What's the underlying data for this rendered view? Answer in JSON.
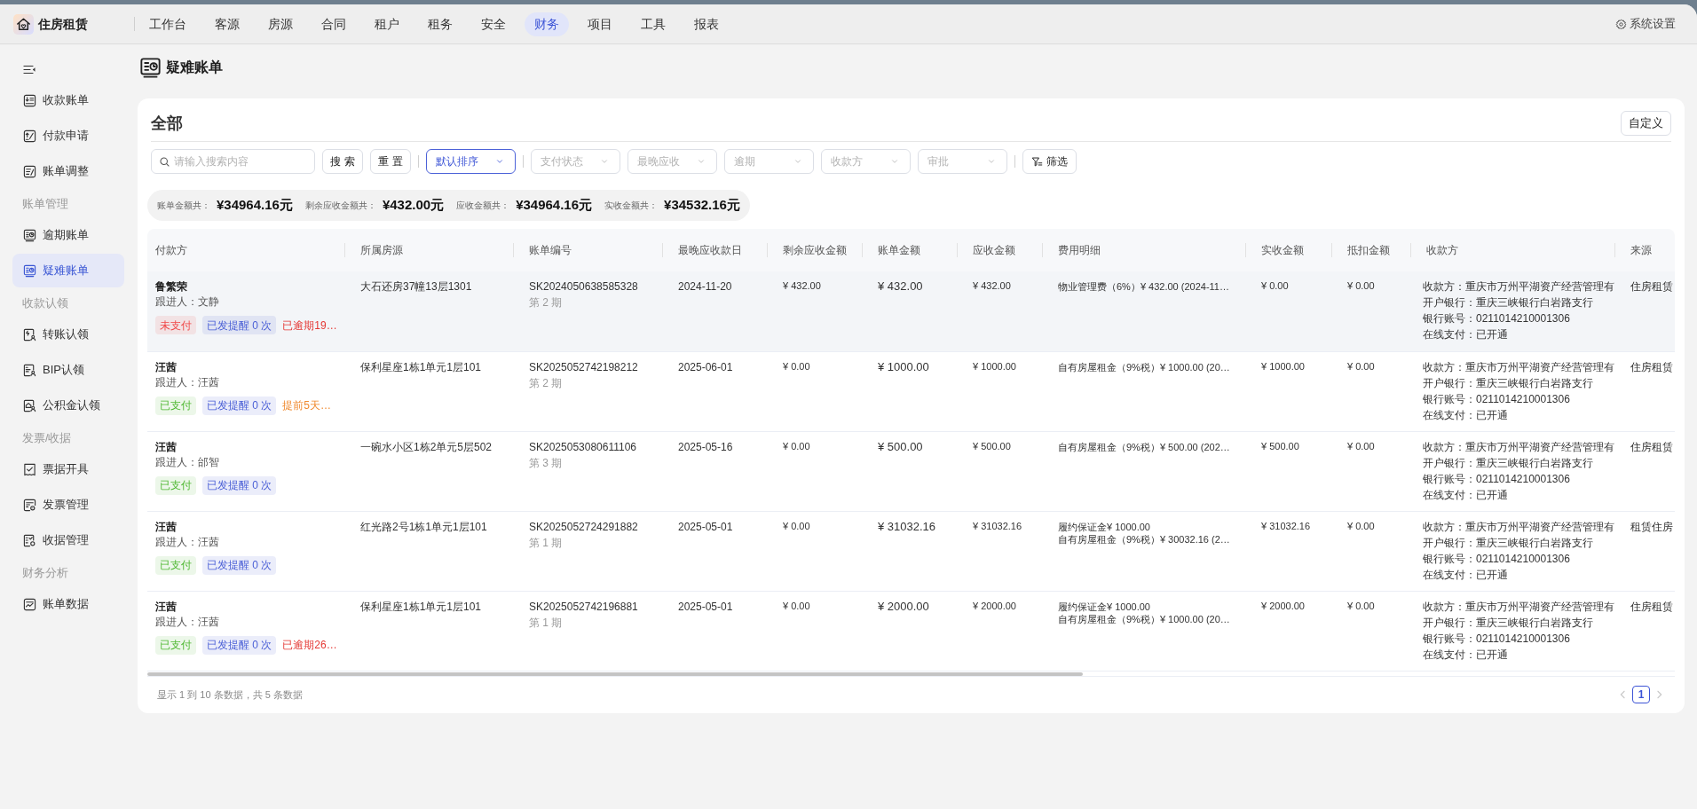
{
  "app": {
    "name": "住房租赁"
  },
  "nav": {
    "items": [
      {
        "label": "工作台",
        "selected": false
      },
      {
        "label": "客源",
        "selected": false
      },
      {
        "label": "房源",
        "selected": false
      },
      {
        "label": "合同",
        "selected": false
      },
      {
        "label": "租户",
        "selected": false
      },
      {
        "label": "租务",
        "selected": false
      },
      {
        "label": "安全",
        "selected": false
      },
      {
        "label": "财务",
        "selected": true
      },
      {
        "label": "项目",
        "selected": false
      },
      {
        "label": "工具",
        "selected": false
      },
      {
        "label": "报表",
        "selected": false
      }
    ],
    "settings": "系统设置"
  },
  "sidebar": {
    "items": [
      {
        "label": "收款账单",
        "selected": false
      },
      {
        "label": "付款申请",
        "selected": false
      },
      {
        "label": "账单调整",
        "selected": false
      }
    ],
    "groups": [
      {
        "title": "账单管理",
        "items": [
          {
            "label": "逾期账单",
            "selected": false
          },
          {
            "label": "疑难账单",
            "selected": true
          }
        ]
      },
      {
        "title": "收款认领",
        "items": [
          {
            "label": "转账认领",
            "selected": false
          },
          {
            "label": "BIP认领",
            "selected": false
          },
          {
            "label": "公积金认领",
            "selected": false
          }
        ]
      },
      {
        "title": "发票/收据",
        "items": [
          {
            "label": "票据开具",
            "selected": false
          },
          {
            "label": "发票管理",
            "selected": false
          },
          {
            "label": "收据管理",
            "selected": false
          }
        ]
      },
      {
        "title": "财务分析",
        "items": [
          {
            "label": "账单数据",
            "selected": false
          }
        ]
      }
    ]
  },
  "page": {
    "title": "疑难账单"
  },
  "card": {
    "heading": "全部",
    "customize_button": "自定义"
  },
  "filters": {
    "search": {
      "placeholder": "请输入搜索内容"
    },
    "search_button": "搜 索",
    "reset_button": "重 置",
    "sort": {
      "value": "默认排序",
      "active": true
    },
    "selects": [
      {
        "placeholder": "支付状态",
        "active": false
      },
      {
        "placeholder": "最晚应收",
        "active": false
      },
      {
        "placeholder": "逾期",
        "active": false
      },
      {
        "placeholder": "收款方",
        "active": false
      },
      {
        "placeholder": "审批",
        "active": false
      }
    ],
    "filter_button": "筛选"
  },
  "summary": [
    {
      "label": "账单金额共：",
      "value": "¥34964.16元"
    },
    {
      "label": "剩余应收金额共：",
      "value": "¥432.00元"
    },
    {
      "label": "应收金额共：",
      "value": "¥34964.16元"
    },
    {
      "label": "实收金额共：",
      "value": "¥34532.16元"
    }
  ],
  "table": {
    "columns": [
      "付款方",
      "所属房源",
      "账单编号",
      "最晚应收款日",
      "剩余应收金额",
      "账单金额",
      "应收金额",
      "费用明细",
      "实收金额",
      "抵扣金额",
      "收款方",
      "来源"
    ],
    "rows": [
      {
        "highlighted": true,
        "payer": "鲁繁荣",
        "follower": "跟进人：文静",
        "tags": [
          {
            "kind": "badge",
            "text": "未支付",
            "color": "#f04a4a"
          },
          {
            "kind": "badge",
            "text": "已发提醒 0 次",
            "color": "#4a5fd6"
          },
          {
            "kind": "note",
            "text": "已逾期19…",
            "color": "#e53935"
          }
        ],
        "property": "大石还房37幢13层1301",
        "bill_no": "SK2024050638585328",
        "period": "第 2 期",
        "due_date": "2024-11-20",
        "remaining": "¥ 432.00",
        "bill_amount": "¥ 432.00",
        "receivable": "¥ 432.00",
        "fee_details": [
          "物业管理费（6%）¥ 432.00 (2024-11…"
        ],
        "received": "¥ 0.00",
        "deduction": "¥ 0.00",
        "payee": [
          "收款方：重庆市万州平湖资产经营管理有",
          "开户银行：重庆三峡银行白岩路支行",
          "银行账号：0211014210001306",
          "在线支付：已开通"
        ],
        "source": "住房租赁"
      },
      {
        "highlighted": false,
        "payer": "汪茜",
        "follower": "跟进人：汪茜",
        "tags": [
          {
            "kind": "badge",
            "text": "已支付",
            "color": "#52b936"
          },
          {
            "kind": "badge",
            "text": "已发提醒 0 次",
            "color": "#4a5fd6"
          },
          {
            "kind": "note",
            "text": "提前5天…",
            "color": "#f0892e"
          }
        ],
        "property": "保利星座1栋1单元1层101",
        "bill_no": "SK2025052742198212",
        "period": "第 2 期",
        "due_date": "2025-06-01",
        "remaining": "¥ 0.00",
        "bill_amount": "¥ 1000.00",
        "receivable": "¥ 1000.00",
        "fee_details": [
          "自有房屋租金（9%税）¥ 1000.00 (20…"
        ],
        "received": "¥ 1000.00",
        "deduction": "¥ 0.00",
        "payee": [
          "收款方：重庆市万州平湖资产经营管理有",
          "开户银行：重庆三峡银行白岩路支行",
          "银行账号：0211014210001306",
          "在线支付：已开通"
        ],
        "source": "住房租赁"
      },
      {
        "highlighted": false,
        "payer": "汪茜",
        "follower": "跟进人：邰智",
        "tags": [
          {
            "kind": "badge",
            "text": "已支付",
            "color": "#52b936"
          },
          {
            "kind": "badge",
            "text": "已发提醒 0 次",
            "color": "#4a5fd6"
          }
        ],
        "property": "一碗水小区1栋2单元5层502",
        "bill_no": "SK2025053080611106",
        "period": "第 3 期",
        "due_date": "2025-05-16",
        "remaining": "¥ 0.00",
        "bill_amount": "¥ 500.00",
        "receivable": "¥ 500.00",
        "fee_details": [
          "自有房屋租金（9%税）¥ 500.00 (202…"
        ],
        "received": "¥ 500.00",
        "deduction": "¥ 0.00",
        "payee": [
          "收款方：重庆市万州平湖资产经营管理有",
          "开户银行：重庆三峡银行白岩路支行",
          "银行账号：0211014210001306",
          "在线支付：已开通"
        ],
        "source": "住房租赁"
      },
      {
        "highlighted": false,
        "payer": "汪茜",
        "follower": "跟进人：汪茜",
        "tags": [
          {
            "kind": "badge",
            "text": "已支付",
            "color": "#52b936"
          },
          {
            "kind": "badge",
            "text": "已发提醒 0 次",
            "color": "#4a5fd6"
          }
        ],
        "property": "红光路2号1栋1单元1层101",
        "bill_no": "SK2025052724291882",
        "period": "第 1 期",
        "due_date": "2025-05-01",
        "remaining": "¥ 0.00",
        "bill_amount": "¥ 31032.16",
        "receivable": "¥ 31032.16",
        "fee_details": [
          "履约保证金¥ 1000.00",
          "自有房屋租金（9%税）¥ 30032.16 (2…"
        ],
        "received": "¥ 31032.16",
        "deduction": "¥ 0.00",
        "payee": [
          "收款方：重庆市万州平湖资产经营管理有",
          "开户银行：重庆三峡银行白岩路支行",
          "银行账号：0211014210001306",
          "在线支付：已开通"
        ],
        "source": "租赁住房"
      },
      {
        "highlighted": false,
        "payer": "汪茜",
        "follower": "跟进人：汪茜",
        "tags": [
          {
            "kind": "badge",
            "text": "已支付",
            "color": "#52b936"
          },
          {
            "kind": "badge",
            "text": "已发提醒 0 次",
            "color": "#4a5fd6"
          },
          {
            "kind": "note",
            "text": "已逾期26…",
            "color": "#e53935"
          }
        ],
        "property": "保利星座1栋1单元1层101",
        "bill_no": "SK2025052742196881",
        "period": "第 1 期",
        "due_date": "2025-05-01",
        "remaining": "¥ 0.00",
        "bill_amount": "¥ 2000.00",
        "receivable": "¥ 2000.00",
        "fee_details": [
          "履约保证金¥ 1000.00",
          "自有房屋租金（9%税）¥ 1000.00 (20…"
        ],
        "received": "¥ 2000.00",
        "deduction": "¥ 0.00",
        "payee": [
          "收款方：重庆市万州平湖资产经营管理有",
          "开户银行：重庆三峡银行白岩路支行",
          "银行账号：0211014210001306",
          "在线支付：已开通"
        ],
        "source": "住房租赁"
      }
    ]
  },
  "footer": {
    "info": "显示 1 到 10 条数据，共 5 条数据",
    "pagination": {
      "prev_disabled": true,
      "next_disabled": true,
      "pages": [
        {
          "label": "1",
          "selected": true
        }
      ]
    }
  }
}
